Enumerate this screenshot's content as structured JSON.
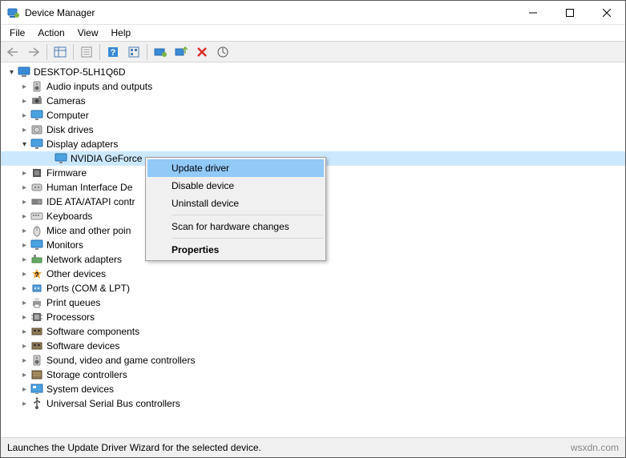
{
  "window": {
    "title": "Device Manager"
  },
  "menu": [
    "File",
    "Action",
    "View",
    "Help"
  ],
  "root": "DESKTOP-5LH1Q6D",
  "categories": [
    {
      "label": "Audio inputs and outputs",
      "icon": "speaker"
    },
    {
      "label": "Cameras",
      "icon": "camera"
    },
    {
      "label": "Computer",
      "icon": "monitor"
    },
    {
      "label": "Disk drives",
      "icon": "disk"
    },
    {
      "label": "Display adapters",
      "icon": "monitor",
      "expanded": true,
      "children": [
        {
          "label": "NVIDIA GeForce",
          "icon": "monitor",
          "selected": true
        }
      ]
    },
    {
      "label": "Firmware",
      "icon": "chip"
    },
    {
      "label": "Human Interface De",
      "icon": "hid"
    },
    {
      "label": "IDE ATA/ATAPI contr",
      "icon": "ide"
    },
    {
      "label": "Keyboards",
      "icon": "keyboard"
    },
    {
      "label": "Mice and other poin",
      "icon": "mouse"
    },
    {
      "label": "Monitors",
      "icon": "monitor"
    },
    {
      "label": "Network adapters",
      "icon": "network"
    },
    {
      "label": "Other devices",
      "icon": "other"
    },
    {
      "label": "Ports (COM & LPT)",
      "icon": "port"
    },
    {
      "label": "Print queues",
      "icon": "printer"
    },
    {
      "label": "Processors",
      "icon": "cpu"
    },
    {
      "label": "Software components",
      "icon": "component"
    },
    {
      "label": "Software devices",
      "icon": "component"
    },
    {
      "label": "Sound, video and game controllers",
      "icon": "speaker"
    },
    {
      "label": "Storage controllers",
      "icon": "storage"
    },
    {
      "label": "System devices",
      "icon": "system"
    },
    {
      "label": "Universal Serial Bus controllers",
      "icon": "usb"
    }
  ],
  "ctx": {
    "update": "Update driver",
    "disable": "Disable device",
    "uninstall": "Uninstall device",
    "scan": "Scan for hardware changes",
    "props": "Properties"
  },
  "status": "Launches the Update Driver Wizard for the selected device.",
  "watermark": "wsxdn.com"
}
